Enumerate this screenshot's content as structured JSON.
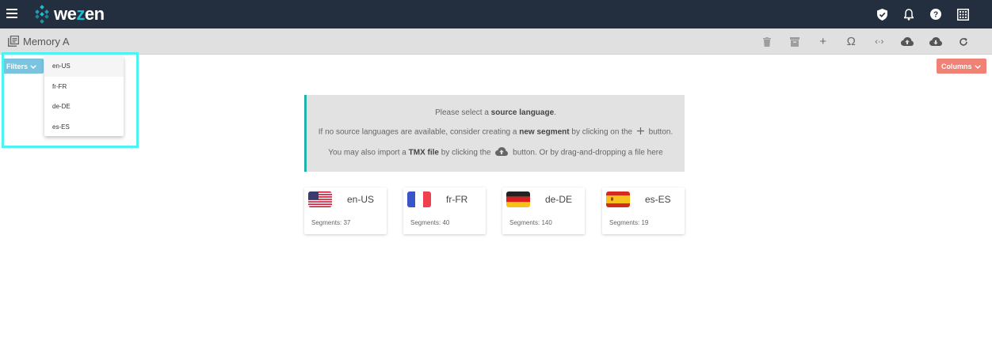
{
  "app": {
    "logo_prefix": "we",
    "logo_accent": "z",
    "logo_suffix": "en",
    "brand_color": "#1fbcd2",
    "header_bg": "#232f3e"
  },
  "topbar": {
    "icons": [
      "shield-check-icon",
      "bell-icon",
      "help-icon",
      "grid-apps-icon"
    ]
  },
  "toolbar": {
    "memory_title": "Memory A",
    "actions": [
      "delete-icon",
      "archive-icon",
      "add-icon",
      "omega-icon",
      "code-icon",
      "cloud-upload-icon",
      "cloud-download-icon",
      "refresh-icon"
    ],
    "add_symbol": "+",
    "omega_symbol": "Ω",
    "code_symbol": "‹·›",
    "refresh_symbol": "C"
  },
  "filters": {
    "label": "Filters",
    "color": "#7ac4e0",
    "options": [
      "en-US",
      "fr-FR",
      "de-DE",
      "es-ES"
    ]
  },
  "columns": {
    "label": "Columns",
    "color": "#ef8274"
  },
  "info": {
    "line1_pre": "Please select a ",
    "line1_bold": "source language",
    "line1_post": ".",
    "line2_pre": "If no source languages are available, consider creating a ",
    "line2_bold": "new segment",
    "line2_mid": " by clicking on the ",
    "line2_post": " button.",
    "line3_pre": "You may also import a ",
    "line3_bold": "TMX file",
    "line3_mid": " by clicking the ",
    "line3_post": " button. Or by drag-and-dropping a file here",
    "accent": "#20b2aa"
  },
  "languages": [
    {
      "code": "en-US",
      "segments": "Segments: 37"
    },
    {
      "code": "fr-FR",
      "segments": "Segments: 40"
    },
    {
      "code": "de-DE",
      "segments": "Segments: 140"
    },
    {
      "code": "es-ES",
      "segments": "Segments: 19"
    }
  ]
}
